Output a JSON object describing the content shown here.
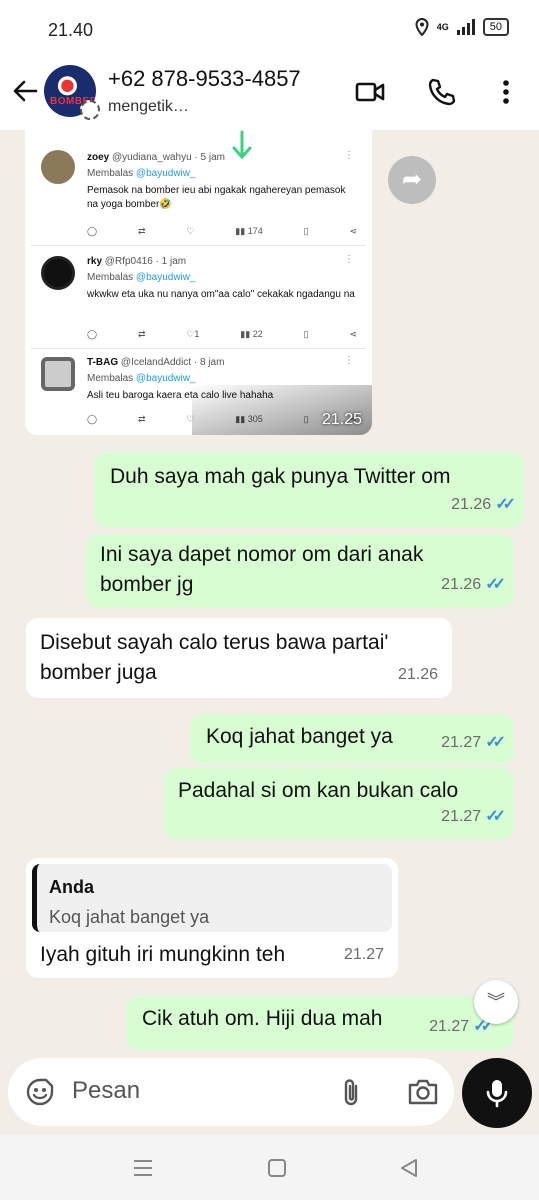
{
  "status_bar": {
    "time": "21.40",
    "network": "4G",
    "battery": "50"
  },
  "header": {
    "contact_name": "+62 878-9533-4857",
    "typing_status": "mengetik…",
    "avatar_text": "BOMBER"
  },
  "screenshot": {
    "time": "21.25",
    "tweets": [
      {
        "name": "zoey",
        "handle": "@yudiana_wahyu · 5 jam",
        "reply_label": "Membalas",
        "reply_to": "@bayudwiw_",
        "text": "Pemasok na bomber ieu abi ngakak ngahereyan pemasok na yoga bomber🤣",
        "views": "174",
        "likes": ""
      },
      {
        "name": "rky",
        "handle": "@Rfp0416 · 1 jam",
        "reply_label": "Membalas",
        "reply_to": "@bayudwiw_",
        "text": "wkwkw eta uka nu nanya om\"aa calo\"  cekakak ngadangu na",
        "views": "22",
        "likes": "1"
      },
      {
        "name": "T-BAG",
        "handle": "@IcelandAddict · 8 jam",
        "reply_label": "Membalas",
        "reply_to": "@bayudwiw_",
        "text": "Asli teu baroga kaera eta calo live hahaha",
        "views": "305",
        "likes": ""
      }
    ]
  },
  "messages": [
    {
      "dir": "out",
      "text": "Duh saya mah gak punya Twitter om",
      "time": "21.26"
    },
    {
      "dir": "out",
      "text": "Ini saya dapet nomor om dari anak bomber jg",
      "time": "21.26"
    },
    {
      "dir": "in",
      "text": "Disebut sayah calo terus bawa partai' bomber juga",
      "time": "21.26"
    },
    {
      "dir": "out",
      "text": "Koq jahat banget ya",
      "time": "21.27"
    },
    {
      "dir": "out",
      "text": "Padahal si om kan bukan calo",
      "time": "21.27"
    },
    {
      "dir": "in",
      "quote_name": "Anda",
      "quote_text": "Koq jahat banget ya",
      "text": "Iyah gituh iri mungkinn teh",
      "time": "21.27"
    },
    {
      "dir": "out",
      "text": "Cik atuh om. Hiji dua mah",
      "time": "21.27"
    }
  ],
  "input": {
    "placeholder": "Pesan"
  },
  "colors": {
    "out_bubble": "#d9fdd3",
    "in_bubble": "#ffffff",
    "read_ticks": "#3e8ed0",
    "background": "#f2ede6"
  }
}
